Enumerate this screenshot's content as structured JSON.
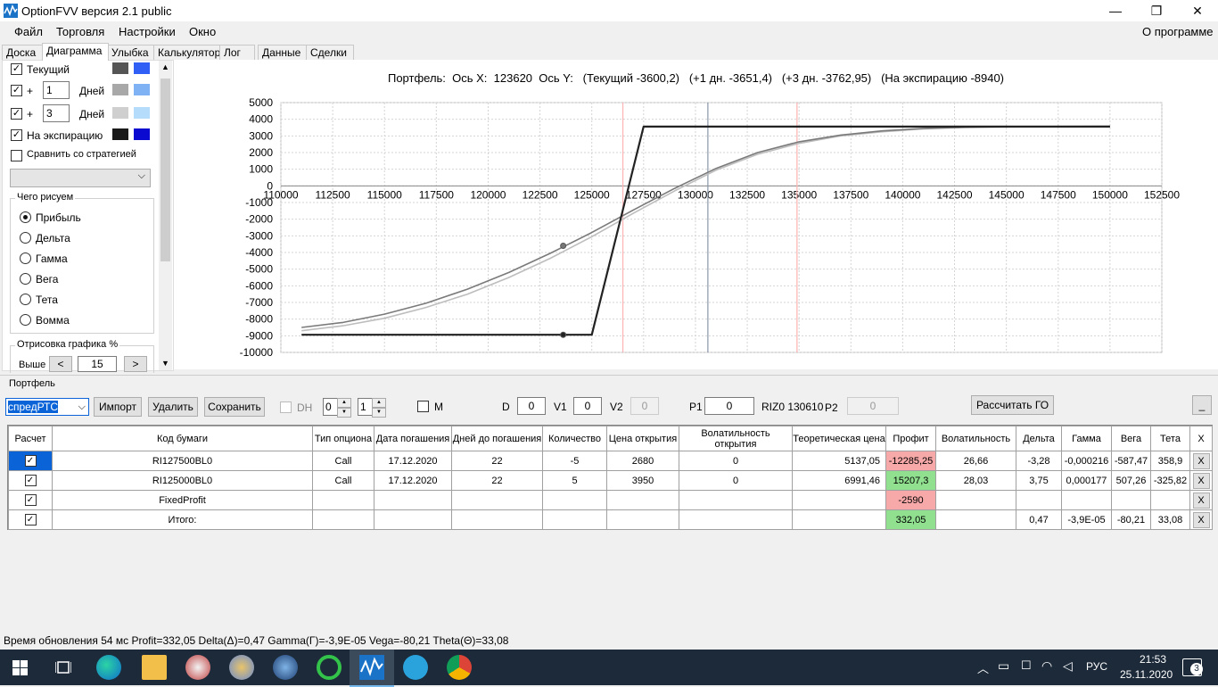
{
  "window": {
    "title": "OptionFVV версия 2.1 public"
  },
  "menu": {
    "items": [
      "Файл",
      "Торговля",
      "Настройки",
      "Окно"
    ],
    "about": "О программе"
  },
  "tabs": [
    "Доска",
    "Диаграмма",
    "Улыбка",
    "Калькулятор",
    "Лог",
    "Данные",
    "Сделки"
  ],
  "left": {
    "current_label": "Текущий",
    "plus1_sign": "+",
    "plus1_value": "1",
    "plus1_days": "Дней",
    "plus3_sign": "+",
    "plus3_value": "3",
    "plus3_days": "Дней",
    "expiry_label": "На экспирацию",
    "compare_label": "Сравнить со стратегией",
    "what_group": "Чего рисуем",
    "radios": [
      "Прибыль",
      "Дельта",
      "Гамма",
      "Вега",
      "Тета",
      "Вомма"
    ],
    "draw_group": "Отрисовка графика %",
    "above_label": "Выше",
    "above_dec": "<",
    "above_value": "15",
    "above_inc": ">"
  },
  "chart_data": {
    "type": "line",
    "title": "Портфель:  Ось X:  123620  Ось Y:   (Текущий -3600,2)   (+1 дн. -3651,4)   (+3 дн. -3762,95)   (На экспирацию -8940)",
    "xlim": [
      110000,
      152500
    ],
    "ylim": [
      -10000,
      5000
    ],
    "xticks": [
      110000,
      112500,
      115000,
      117500,
      120000,
      122500,
      125000,
      127500,
      130000,
      132500,
      135000,
      137500,
      140000,
      142500,
      145000,
      147500,
      150000,
      152500
    ],
    "yticks": [
      5000,
      4000,
      3000,
      2000,
      1000,
      0,
      -1000,
      -2000,
      -3000,
      -4000,
      -5000,
      -6000,
      -7000,
      -8000,
      -9000,
      -10000
    ],
    "grid": true,
    "vlines": [
      {
        "x": 126500,
        "color": "#ffb3b3"
      },
      {
        "x": 130600,
        "color": "#8a96a8"
      },
      {
        "x": 134900,
        "color": "#ffb3b3"
      }
    ],
    "series": [
      {
        "color": "#bdbdbd",
        "x": [
          111000,
          113000,
          115000,
          117000,
          119000,
          121000,
          123000,
          125000,
          127000,
          129000,
          131000,
          133000,
          135000,
          137000,
          139000,
          141000,
          143000,
          145000,
          147000,
          150000
        ],
        "y": [
          -8700,
          -8400,
          -7950,
          -7300,
          -6500,
          -5500,
          -4350,
          -3050,
          -1650,
          -300,
          950,
          1900,
          2550,
          3000,
          3250,
          3420,
          3500,
          3540,
          3560,
          3570
        ]
      },
      {
        "color": "#7a7a7a",
        "x": [
          111000,
          113000,
          115000,
          117000,
          119000,
          121000,
          123000,
          125000,
          127000,
          129000,
          131000,
          133000,
          135000,
          137000,
          139000,
          141000,
          143000,
          145000,
          147000,
          150000
        ],
        "y": [
          -8500,
          -8200,
          -7700,
          -7050,
          -6200,
          -5200,
          -4050,
          -2800,
          -1450,
          -150,
          1050,
          2000,
          2650,
          3050,
          3300,
          3450,
          3520,
          3550,
          3565,
          3575
        ]
      },
      {
        "color": "#222222",
        "x": [
          111000,
          125000,
          127500,
          128000,
          150000
        ],
        "y": [
          -8940,
          -8940,
          3560,
          3560,
          3560
        ]
      }
    ],
    "markers": [
      {
        "x": 123620,
        "y": -3600,
        "color": "#777777"
      },
      {
        "x": 123620,
        "y": -8940,
        "color": "#222222"
      }
    ]
  },
  "portfolio": {
    "group_label": "Портфель",
    "combo_value": "спредРТС",
    "import_label": "Импорт",
    "delete_label": "Удалить",
    "save_label": "Сохранить",
    "dh_label": "DH",
    "spin1": "0",
    "spin2": "1",
    "m_label": "M",
    "d_label": "D",
    "d_value": "0",
    "v1_label": "V1",
    "v1_value": "0",
    "v2_label": "V2",
    "v2_value": "0",
    "p1_label": "P1",
    "p1_value": "0",
    "instrument": "RIZ0 130610",
    "p2_label": "P2",
    "p2_value": "0",
    "calc_label": "Рассчитать ГО",
    "min_label": "_"
  },
  "table": {
    "columns": [
      "Расчет",
      "Код бумаги",
      "Тип опциона",
      "Дата погашения",
      "Дней до погашения",
      "Количество",
      "Цена открытия",
      "Волатильность открытия",
      "Теоретическая цена",
      "Профит",
      "Волатильность",
      "Дельта",
      "Гамма",
      "Вега",
      "Тета",
      "X"
    ],
    "rows": [
      {
        "check": "✓",
        "code": "RI127500BL0",
        "type": "Call",
        "date": "17.12.2020",
        "days": "22",
        "qty": "-5",
        "open": "2680",
        "vol_open": "0",
        "theo": "5137,05",
        "profit": "-12285,25",
        "vol": "26,66",
        "delta": "-3,28",
        "gamma": "-0,000216",
        "vega": "-587,47",
        "theta": "358,9",
        "x": "X"
      },
      {
        "check": "✓",
        "code": "RI125000BL0",
        "type": "Call",
        "date": "17.12.2020",
        "days": "22",
        "qty": "5",
        "open": "3950",
        "vol_open": "0",
        "theo": "6991,46",
        "profit": "15207,3",
        "vol": "28,03",
        "delta": "3,75",
        "gamma": "0,000177",
        "vega": "507,26",
        "theta": "-325,82",
        "x": "X"
      },
      {
        "check": "✓",
        "code": "FixedProfit",
        "type": "",
        "date": "",
        "days": "",
        "qty": "",
        "open": "",
        "vol_open": "",
        "theo": "",
        "profit": "-2590",
        "vol": "",
        "delta": "",
        "gamma": "",
        "vega": "",
        "theta": "",
        "x": "X"
      },
      {
        "check": "✓",
        "code": "Итого:",
        "type": "",
        "date": "",
        "days": "",
        "qty": "",
        "open": "",
        "vol_open": "",
        "theo": "",
        "profit": "332,05",
        "vol": "",
        "delta": "0,47",
        "gamma": "-3,9E-05",
        "vega": "-80,21",
        "theta": "33,08",
        "x": "X"
      }
    ],
    "colors": {
      "negative": "#f7a8a8",
      "positive": "#90e090",
      "selected": "#0a64d8"
    }
  },
  "status": {
    "text": "Время обновления 54 мс  Profit=332,05 Delta(Δ)=0,47 Gamma(Γ)=-3,9E-05 Vega=-80,21 Theta(Θ)=33,08"
  },
  "taskbar": {
    "lang": "РУС",
    "time": "21:53",
    "date": "25.11.2020",
    "notif_count": "3"
  }
}
